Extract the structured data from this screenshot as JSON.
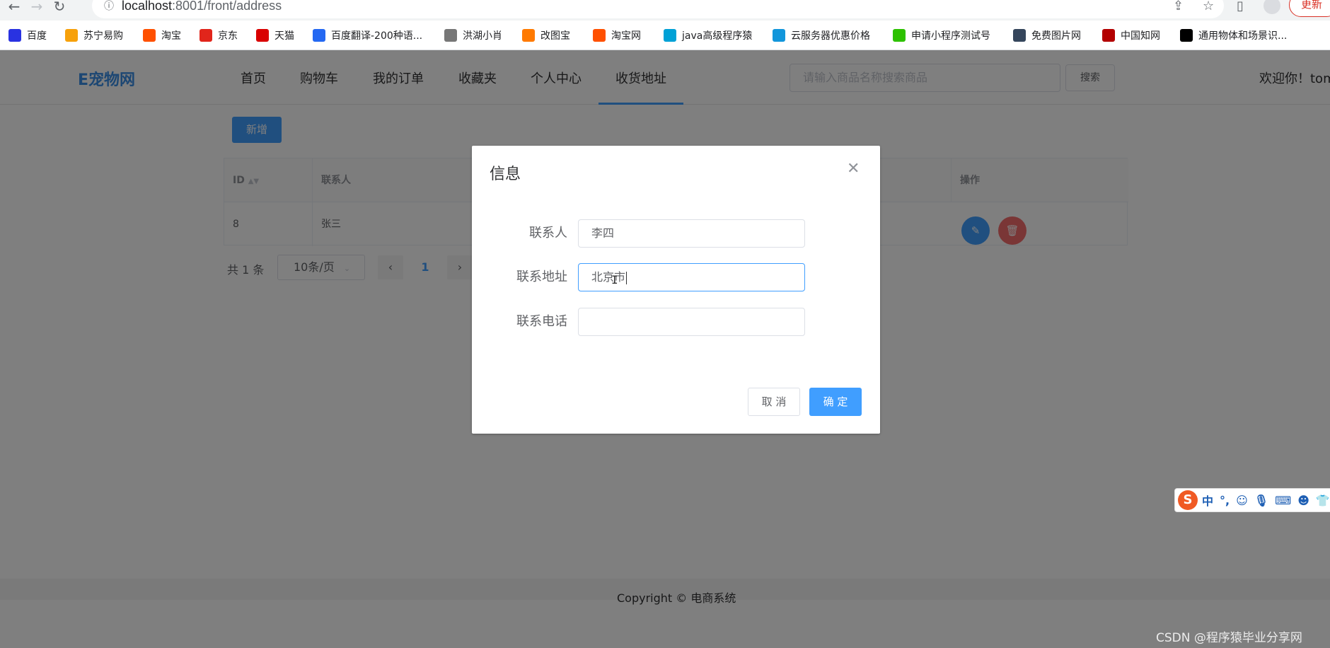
{
  "browser": {
    "url_host": "localhost",
    "url_rest": ":8001/front/address",
    "update_label": "更新",
    "bookmarks": [
      {
        "label": "百度",
        "icon": "baidu-paw-icon",
        "color": "#2932e1"
      },
      {
        "label": "苏宁易购",
        "icon": "suning-icon",
        "color": "#f7a10b"
      },
      {
        "label": "淘宝",
        "icon": "taobao-icon",
        "color": "#ff5000"
      },
      {
        "label": "京东",
        "icon": "jd-icon",
        "color": "#e1251b"
      },
      {
        "label": "天猫",
        "icon": "tmall-icon",
        "color": "#d90000"
      },
      {
        "label": "百度翻译-200种语...",
        "icon": "translate-icon",
        "color": "#2468f2"
      },
      {
        "label": "洪湖小肖",
        "icon": "wings-icon",
        "color": "#777777"
      },
      {
        "label": "改图宝",
        "icon": "gaitubao-icon",
        "color": "#ff7a00"
      },
      {
        "label": "淘宝网",
        "icon": "taobao-icon",
        "color": "#ff5000"
      },
      {
        "label": "java高级程序猿",
        "icon": "bilibili-icon",
        "color": "#00a1d6"
      },
      {
        "label": "云服务器优惠价格",
        "icon": "cloud-icon",
        "color": "#1296db"
      },
      {
        "label": "申请小程序测试号",
        "icon": "wechat-icon",
        "color": "#2dc100"
      },
      {
        "label": "免费图片网",
        "icon": "tumblr-icon",
        "color": "#35465c"
      },
      {
        "label": "中国知网",
        "icon": "cnki-icon",
        "color": "#b30000"
      },
      {
        "label": "通用物体和场景识...",
        "icon": "ai-icon",
        "color": "#000000"
      }
    ]
  },
  "header": {
    "logo": "E宠物网",
    "menu": [
      "首页",
      "购物车",
      "我的订单",
      "收藏夹",
      "个人中心",
      "收货地址"
    ],
    "active_menu": "收货地址",
    "search_placeholder": "请输入商品名称搜索商品",
    "search_button": "搜索",
    "welcome": "欢迎你！tom"
  },
  "main": {
    "add_button": "新增",
    "table": {
      "columns": [
        "ID",
        "联系人",
        "操作"
      ],
      "rows": [
        {
          "id": "8",
          "contact": "张三"
        }
      ]
    },
    "pagination": {
      "total": "共 1 条",
      "page_size": "10条/页",
      "current": "1"
    }
  },
  "footer": {
    "text": "Copyright © 电商系统"
  },
  "dialog": {
    "title": "信息",
    "fields": [
      {
        "label": "联系人",
        "value": "李四"
      },
      {
        "label": "联系地址",
        "value": "北京市"
      },
      {
        "label": "联系电话",
        "value": ""
      }
    ],
    "cancel": "取 消",
    "confirm": "确 定"
  },
  "ime": {
    "logo": "S",
    "mode": "中",
    "punct": "°,"
  },
  "watermark": "CSDN @程序猿毕业分享网",
  "colors": {
    "primary": "#409eff",
    "danger": "#f56c6c",
    "edit": "#409eff"
  }
}
